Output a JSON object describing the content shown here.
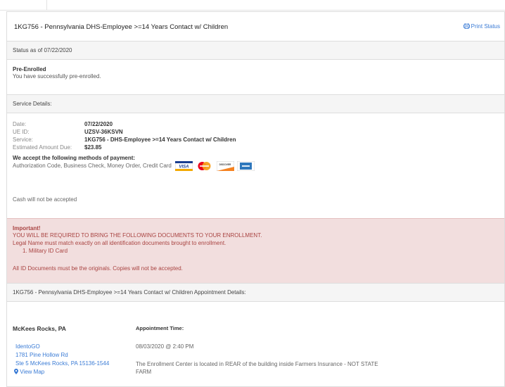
{
  "header": {
    "title": "1KG756 - Pennsylvania DHS-Employee >=14 Years Contact w/ Children",
    "print_label": "Print Status"
  },
  "status": {
    "heading": "Status as of 07/22/2020",
    "state": "Pre-Enrolled",
    "message": "You have successfully pre-enrolled."
  },
  "service": {
    "heading": "Service Details:",
    "rows": [
      {
        "label": "Date:",
        "value": "07/22/2020"
      },
      {
        "label": "UE ID:",
        "value": "UZSV-36KSVN"
      },
      {
        "label": "Service:",
        "value": "1KG756 - DHS-Employee >=14 Years Contact w/ Children"
      },
      {
        "label": "Estimated Amount Due:",
        "value": "$23.85"
      }
    ],
    "payment_heading": "We accept the following methods of payment:",
    "payment_methods": "Authorization Code, Business Check, Money Order, Credit Card",
    "cards": [
      "visa-card-icon",
      "mastercard-icon",
      "discover-card-icon",
      "amex-card-icon"
    ],
    "card_labels": {
      "visa": "VISA",
      "discover": "DISCOVER"
    },
    "cash_note": "Cash will not be accepted"
  },
  "important": {
    "heading": "Important!",
    "line1": "YOU WILL BE REQUIRED TO BRING THE FOLLOWING DOCUMENTS TO YOUR ENROLLMENT.",
    "line2": "Legal Name must match exactly on all identification documents brought to enrollment.",
    "item1": "1. Military ID Card",
    "line3": "All ID Documents must be the originals. Copies will not be accepted."
  },
  "appointment": {
    "heading": "1KG756 - Pennsylvania DHS-Employee >=14 Years Contact w/ Children Appointment Details:",
    "location": "McKees Rocks, PA",
    "center_name": "IdentoGO",
    "address1": "1781 Pine Hollow Rd",
    "address2": "Ste 5 McKees Rocks, PA 15136-1544",
    "map_label": "View Map",
    "time_label": "Appointment Time:",
    "time_value": "08/03/2020 @ 2:40 PM",
    "note_line1": "The Enrollment Center is located in REAR of the building inside Farmers Insurance - NOT STATE",
    "note_line2": "FARM"
  },
  "colors": {
    "link": "#3a7bd5",
    "alert_bg": "#f2dede",
    "alert_text": "#a94442",
    "section_bg": "#f5f5f5"
  }
}
